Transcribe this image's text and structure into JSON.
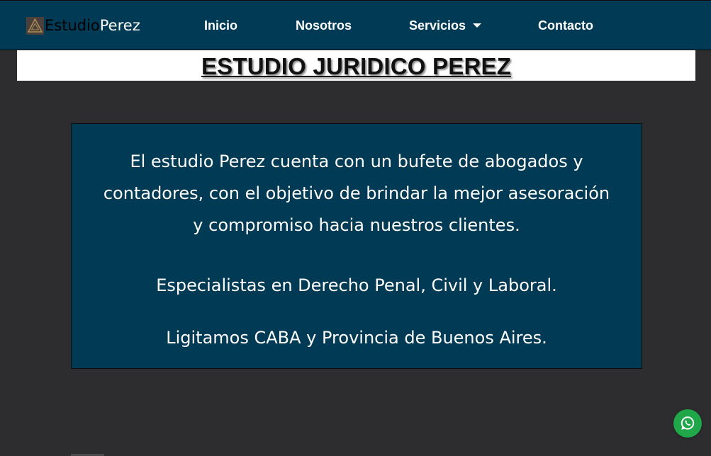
{
  "brand": {
    "part1": "Estudio",
    "part2": "Perez",
    "logo_icon": "triangle-logo-icon"
  },
  "nav": {
    "items": [
      {
        "label": "Inicio"
      },
      {
        "label": "Nosotros"
      },
      {
        "label": "Servicios",
        "has_dropdown": true
      },
      {
        "label": "Contacto"
      }
    ]
  },
  "header": {
    "title": "ESTUDIO JURIDICO PEREZ"
  },
  "about": {
    "line1": "El estudio Perez cuenta con un bufete de abogados y",
    "line2": "contadores, con el objetivo de brindar la mejor asesoración",
    "line3": "y compromiso hacia nuestros clientes.",
    "specialties": "Especialistas en Derecho Penal, Civil y Laboral.",
    "coverage": "Ligitamos CABA y Provincia de Buenos Aires."
  },
  "floating": {
    "whatsapp_icon": "whatsapp-icon"
  },
  "colors": {
    "navbar": "#003a54",
    "background": "#2d2c2e",
    "panel": "#003a54",
    "whatsapp": "#1fa74a"
  }
}
